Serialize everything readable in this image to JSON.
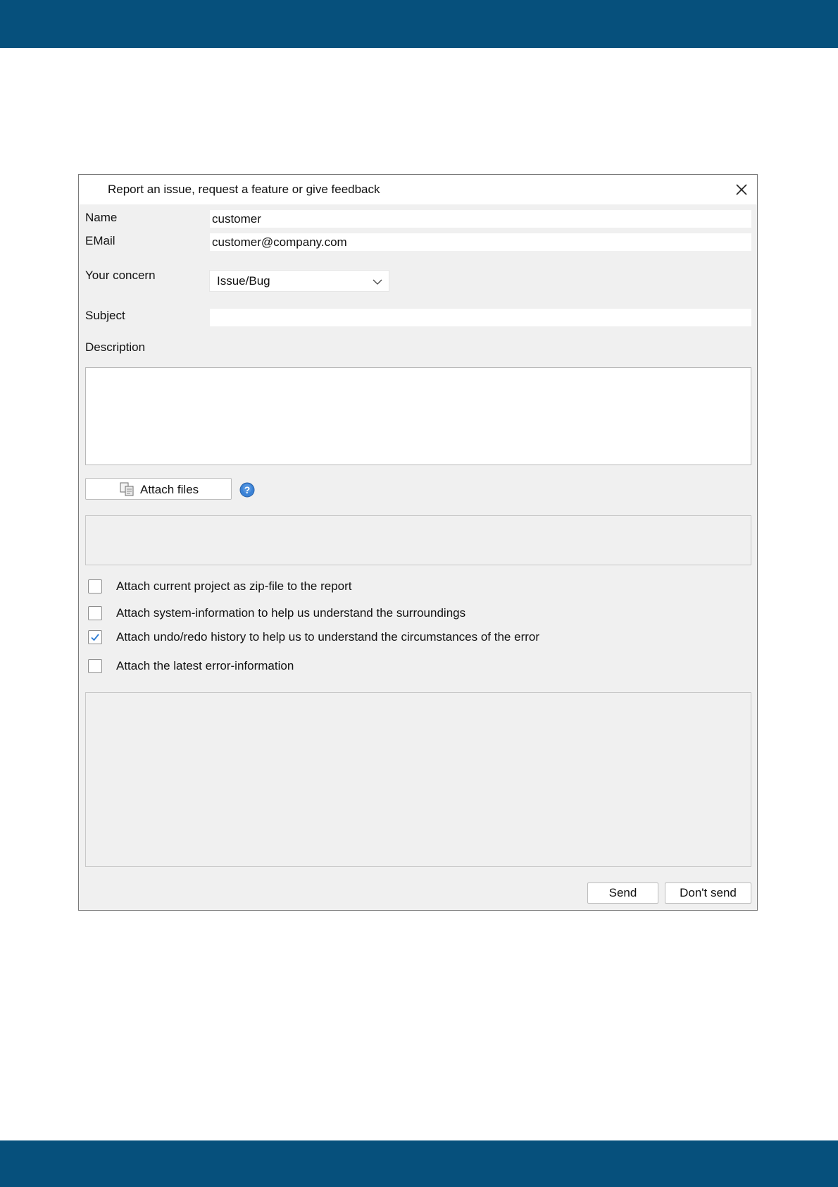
{
  "dialog": {
    "title": "Report an issue, request a feature or give feedback"
  },
  "form": {
    "name_label": "Name",
    "name_value": "customer",
    "email_label": "EMail",
    "email_value": "customer@company.com",
    "concern_label": "Your concern",
    "concern_value": "Issue/Bug",
    "subject_label": "Subject",
    "subject_value": "",
    "description_label": "Description",
    "description_value": ""
  },
  "attachments": {
    "button_label": "Attach files"
  },
  "options": [
    {
      "label": "Attach current project as zip-file to the report",
      "checked": false
    },
    {
      "label": "Attach system-information to help us understand the surroundings",
      "checked": false
    },
    {
      "label": "Attach undo/redo history to help us to understand the circumstances of the error",
      "checked": true
    },
    {
      "label": "Attach the latest error-information",
      "checked": false
    }
  ],
  "buttons": {
    "send": "Send",
    "dont_send": "Don't send"
  },
  "colors": {
    "band": "#06507c",
    "dialog_bg": "#f0f0f0",
    "check_accent": "#2a7bd4",
    "help_blue": "#3b82d6"
  },
  "icons": {
    "close": "close-icon",
    "dropdown": "chevron-down-icon",
    "attach": "attach-files-icon",
    "help": "help-icon",
    "check": "checkmark-icon"
  }
}
